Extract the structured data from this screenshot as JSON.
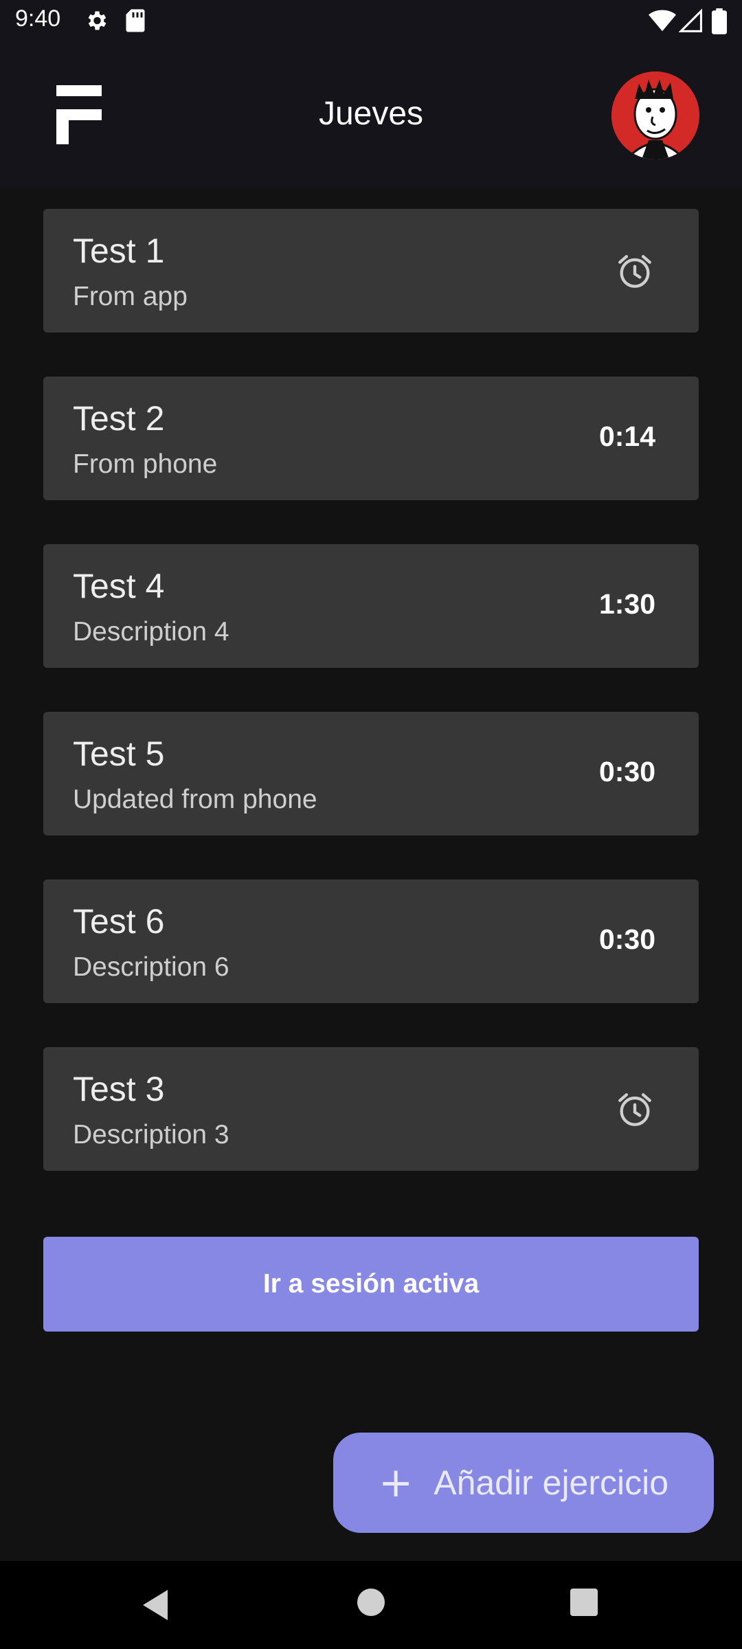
{
  "status_bar": {
    "time": "9:40"
  },
  "header": {
    "title": "Jueves"
  },
  "exercises": [
    {
      "name": "Test 1",
      "description": "From app",
      "duration": "",
      "icon": "alarm-icon"
    },
    {
      "name": "Test 2",
      "description": "From phone",
      "duration": "0:14",
      "icon": ""
    },
    {
      "name": "Test 4",
      "description": "Description 4",
      "duration": "1:30",
      "icon": ""
    },
    {
      "name": "Test 5",
      "description": "Updated from phone",
      "duration": "0:30",
      "icon": ""
    },
    {
      "name": "Test 6",
      "description": "Description 6",
      "duration": "0:30",
      "icon": ""
    },
    {
      "name": "Test 3",
      "description": "Description 3",
      "duration": "",
      "icon": "alarm-icon"
    }
  ],
  "active_session_button": "Ir a sesión activa",
  "fab": {
    "label": "Añadir ejercicio"
  },
  "colors": {
    "accent": "#8787e4",
    "card": "#373737",
    "background": "#121212",
    "appbar": "#16141b"
  }
}
